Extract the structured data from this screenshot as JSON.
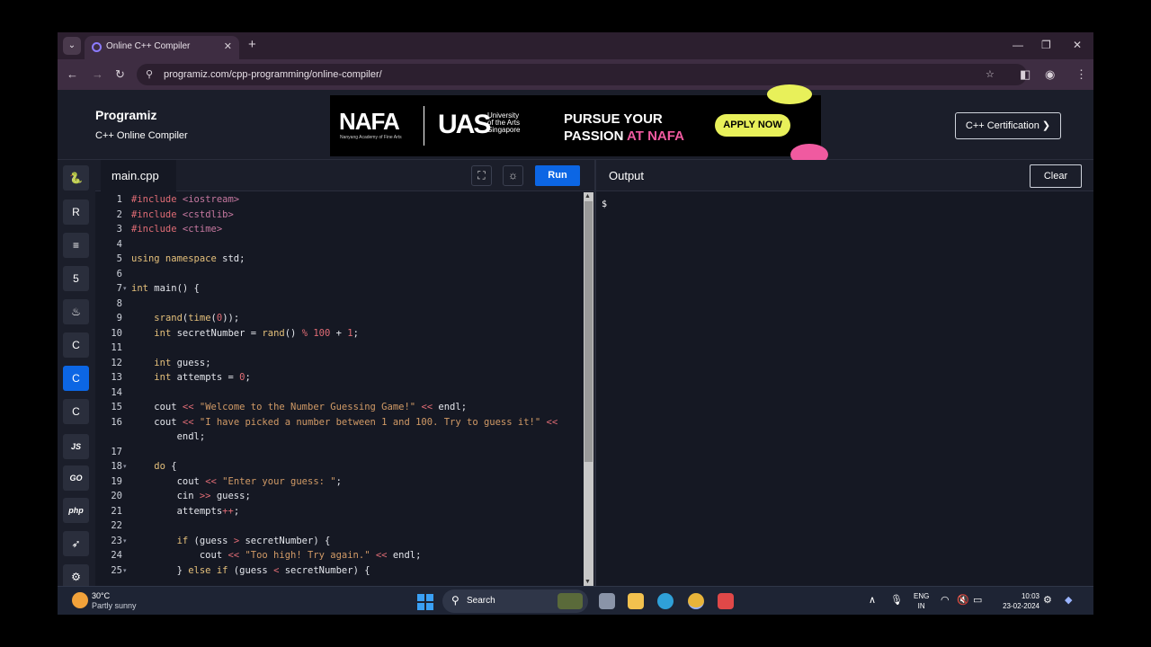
{
  "browser": {
    "tab_title": "Online C++ Compiler",
    "tab_close": "✕",
    "new_tab": "+",
    "url": "programiz.com/cpp-programming/online-compiler/",
    "icons": {
      "back": "←",
      "forward": "→",
      "reload": "↻",
      "star": "☆",
      "minimize": "—",
      "maximize": "❐",
      "close": "✕",
      "menu": "⋮"
    }
  },
  "header": {
    "logo": "Programiz",
    "subtitle": "C++ Online Compiler",
    "certification_button": "C++ Certification ❯"
  },
  "ad": {
    "nafa": "NAFA",
    "nafa_sub": "Nanyang Academy of Fine Arts",
    "uas": "UAS",
    "uni_line1": "University",
    "uni_line2": "of the Arts",
    "uni_line3": "Singapore",
    "pursue_line1": "PURSUE YOUR",
    "pursue_line2a": "PASSION ",
    "pursue_line2b": "AT NAFA",
    "apply": "APPLY NOW"
  },
  "languages": [
    {
      "name": "python",
      "glyph": "🐍"
    },
    {
      "name": "r",
      "glyph": "R"
    },
    {
      "name": "sql",
      "glyph": "≡"
    },
    {
      "name": "html",
      "glyph": "5"
    },
    {
      "name": "java",
      "glyph": "♨"
    },
    {
      "name": "c",
      "glyph": "C"
    },
    {
      "name": "cpp",
      "glyph": "C"
    },
    {
      "name": "csharp",
      "glyph": "C"
    },
    {
      "name": "js",
      "glyph": "JS"
    },
    {
      "name": "go",
      "glyph": "GO"
    },
    {
      "name": "php",
      "glyph": "php"
    },
    {
      "name": "swift",
      "glyph": "➶"
    },
    {
      "name": "rust",
      "glyph": "⚙"
    }
  ],
  "editor": {
    "filename": "main.cpp",
    "run_label": "Run",
    "lines": [
      {
        "n": "1",
        "html": "<span style='color:#e06c75'>#include</span> <span style='color:#c678a0'>&lt;iostream&gt;</span>"
      },
      {
        "n": "2",
        "html": "<span style='color:#e06c75'>#include</span> <span style='color:#c678a0'>&lt;cstdlib&gt;</span>"
      },
      {
        "n": "3",
        "html": "<span style='color:#e06c75'>#include</span> <span style='color:#c678a0'>&lt;ctime&gt;</span>"
      },
      {
        "n": "4",
        "html": ""
      },
      {
        "n": "5",
        "html": "<span style='color:#e5c07b'>using namespace</span> std;"
      },
      {
        "n": "6",
        "html": ""
      },
      {
        "n": "7",
        "html": "<span style='color:#e5c07b'>int</span> main() {",
        "fold": true
      },
      {
        "n": "8",
        "html": ""
      },
      {
        "n": "9",
        "html": "    <span style='color:#e5c07b'>srand</span>(<span style='color:#e5c07b'>time</span>(<span style='color:#e06c75'>0</span>));"
      },
      {
        "n": "10",
        "html": "    <span style='color:#e5c07b'>int</span> secretNumber = <span style='color:#e5c07b'>rand</span>() <span style='color:#e06c75'>%</span> <span style='color:#e06c75'>100</span> + <span style='color:#e06c75'>1</span>;"
      },
      {
        "n": "11",
        "html": ""
      },
      {
        "n": "12",
        "html": "    <span style='color:#e5c07b'>int</span> guess;"
      },
      {
        "n": "13",
        "html": "    <span style='color:#e5c07b'>int</span> attempts = <span style='color:#e06c75'>0</span>;"
      },
      {
        "n": "14",
        "html": ""
      },
      {
        "n": "15",
        "html": "    cout <span style='color:#e06c75'>&lt;&lt;</span> <span style='color:#d19a66'>\"Welcome to the Number Guessing Game!\"</span> <span style='color:#e06c75'>&lt;&lt;</span> endl;"
      },
      {
        "n": "16",
        "html": "    cout <span style='color:#e06c75'>&lt;&lt;</span> <span style='color:#d19a66'>\"I have picked a number between 1 and 100. Try to guess it!\"</span> <span style='color:#e06c75'>&lt;&lt;</span>"
      },
      {
        "n": "",
        "html": "        endl;"
      },
      {
        "n": "17",
        "html": ""
      },
      {
        "n": "18",
        "html": "    <span style='color:#e5c07b'>do</span> {",
        "fold": true
      },
      {
        "n": "19",
        "html": "        cout <span style='color:#e06c75'>&lt;&lt;</span> <span style='color:#d19a66'>\"Enter your guess: \"</span>;"
      },
      {
        "n": "20",
        "html": "        cin <span style='color:#e06c75'>&gt;&gt;</span> guess;"
      },
      {
        "n": "21",
        "html": "        attempts<span style='color:#e06c75'>++</span>;"
      },
      {
        "n": "22",
        "html": ""
      },
      {
        "n": "23",
        "html": "        <span style='color:#e5c07b'>if</span> (guess <span style='color:#e06c75'>&gt;</span> secretNumber) {",
        "fold": true
      },
      {
        "n": "24",
        "html": "            cout <span style='color:#e06c75'>&lt;&lt;</span> <span style='color:#d19a66'>\"Too high! Try again.\"</span> <span style='color:#e06c75'>&lt;&lt;</span> endl;"
      },
      {
        "n": "25",
        "html": "        } <span style='color:#e5c07b'>else if</span> (guess <span style='color:#e06c75'>&lt;</span> secretNumber) {",
        "fold": true
      }
    ]
  },
  "output": {
    "title": "Output",
    "clear_label": "Clear",
    "prompt": "$"
  },
  "taskbar": {
    "temp": "30°C",
    "weather": "Partly sunny",
    "search": "Search",
    "lang_line1": "ENG",
    "lang_line2": "IN",
    "time": "10:03",
    "date": "23-02-2024"
  }
}
